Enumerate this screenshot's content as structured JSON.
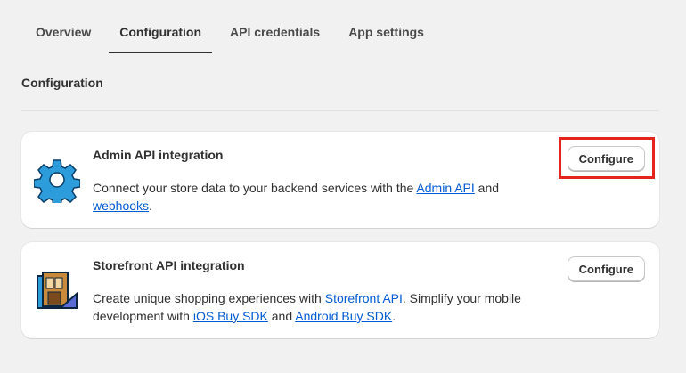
{
  "tabs": [
    {
      "label": "Overview"
    },
    {
      "label": "Configuration"
    },
    {
      "label": "API credentials"
    },
    {
      "label": "App settings"
    }
  ],
  "section": {
    "title": "Configuration"
  },
  "cards": [
    {
      "title": "Admin API integration",
      "desc_pre": "Connect your store data to your backend services with the ",
      "link1": "Admin API",
      "desc_mid": " and ",
      "link2": "webhooks",
      "desc_post": ".",
      "button": "Configure",
      "icon": "gear-icon"
    },
    {
      "title": "Storefront API integration",
      "desc_pre": "Create unique shopping experiences with ",
      "link1": "Storefront API",
      "desc_mid": ". Simplify your mobile development with ",
      "link2": "iOS Buy SDK",
      "desc_mid2": " and ",
      "link3": "Android Buy SDK",
      "desc_post": ".",
      "button": "Configure",
      "icon": "storefront-icon"
    }
  ],
  "colors": {
    "link": "#005bd3",
    "highlight": "#e5251d",
    "gear": "#2d9cdb"
  }
}
